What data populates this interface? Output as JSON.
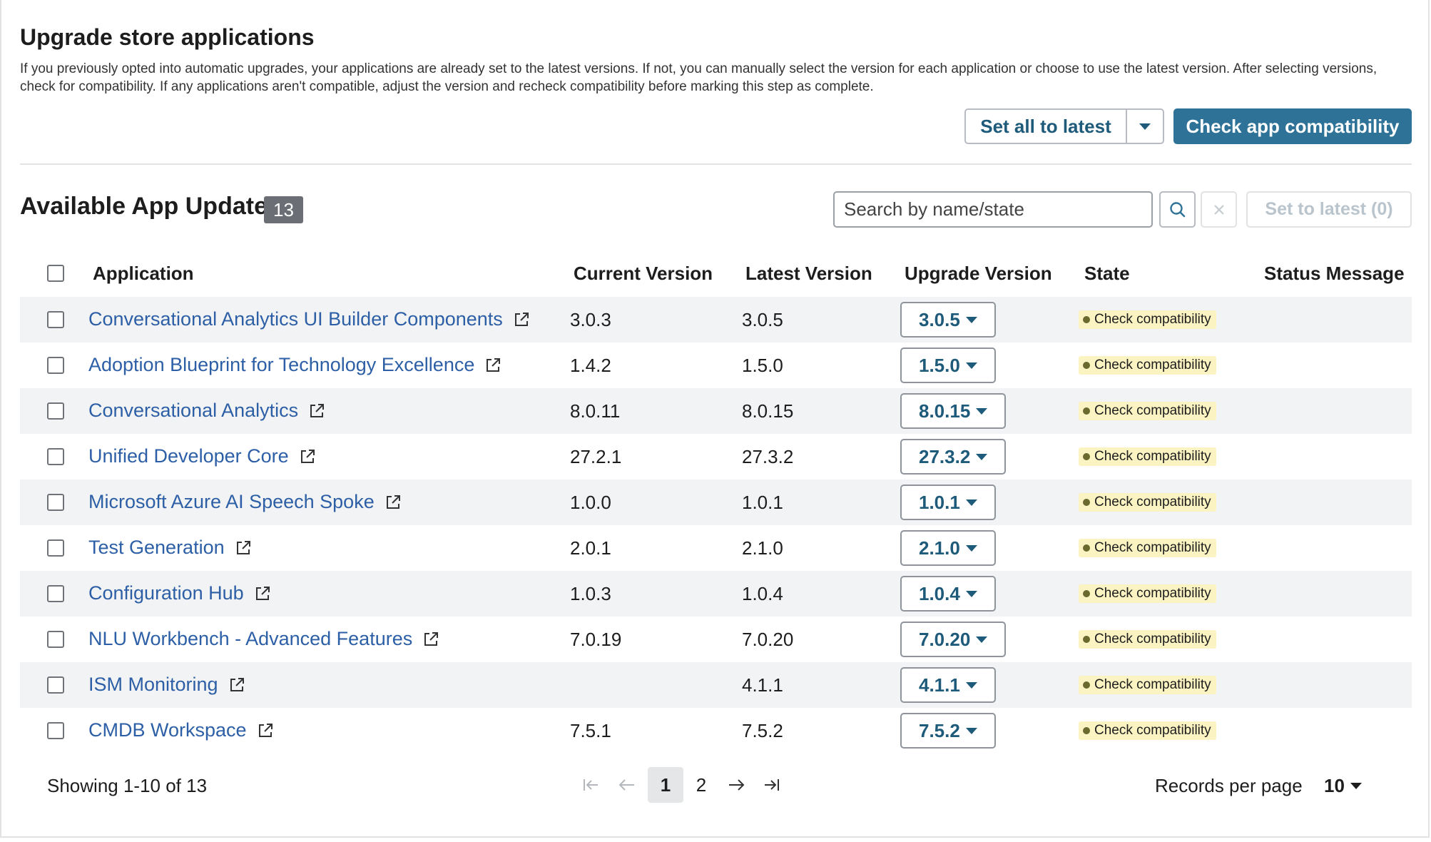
{
  "header": {
    "title": "Upgrade store applications",
    "description": "If you previously opted into automatic upgrades, your applications are already set to the latest versions. If not, you can manually select the version for each application or choose to use the latest version. After selecting versions, check for compatibility. If any applications aren't compatible, adjust the version and recheck compatibility before marking this step as complete.",
    "set_all_label": "Set all to latest",
    "check_compat_label": "Check app compatibility"
  },
  "updates": {
    "title": "Available App Updates",
    "count": "13",
    "search_placeholder": "Search by name/state",
    "set_to_latest_label": "Set to latest (0)"
  },
  "table": {
    "columns": {
      "application": "Application",
      "current": "Current Version",
      "latest": "Latest Version",
      "upgrade": "Upgrade Version",
      "state": "State",
      "status": "Status Message"
    },
    "rows": [
      {
        "name": "Conversational Analytics UI Builder Components",
        "current": "3.0.3",
        "latest": "3.0.5",
        "upgrade": "3.0.5",
        "state": "Check compatibility",
        "status": ""
      },
      {
        "name": "Adoption Blueprint for Technology Excellence",
        "current": "1.4.2",
        "latest": "1.5.0",
        "upgrade": "1.5.0",
        "state": "Check compatibility",
        "status": ""
      },
      {
        "name": "Conversational Analytics",
        "current": "8.0.11",
        "latest": "8.0.15",
        "upgrade": "8.0.15",
        "state": "Check compatibility",
        "status": ""
      },
      {
        "name": "Unified Developer Core",
        "current": "27.2.1",
        "latest": "27.3.2",
        "upgrade": "27.3.2",
        "state": "Check compatibility",
        "status": ""
      },
      {
        "name": "Microsoft Azure AI Speech Spoke",
        "current": "1.0.0",
        "latest": "1.0.1",
        "upgrade": "1.0.1",
        "state": "Check compatibility",
        "status": ""
      },
      {
        "name": "Test Generation",
        "current": "2.0.1",
        "latest": "2.1.0",
        "upgrade": "2.1.0",
        "state": "Check compatibility",
        "status": ""
      },
      {
        "name": "Configuration Hub",
        "current": "1.0.3",
        "latest": "1.0.4",
        "upgrade": "1.0.4",
        "state": "Check compatibility",
        "status": ""
      },
      {
        "name": "NLU Workbench - Advanced Features",
        "current": "7.0.19",
        "latest": "7.0.20",
        "upgrade": "7.0.20",
        "state": "Check compatibility",
        "status": ""
      },
      {
        "name": "ISM Monitoring",
        "current": "",
        "latest": "4.1.1",
        "upgrade": "4.1.1",
        "state": "Check compatibility",
        "status": ""
      },
      {
        "name": "CMDB Workspace",
        "current": "7.5.1",
        "latest": "7.5.2",
        "upgrade": "7.5.2",
        "state": "Check compatibility",
        "status": ""
      }
    ]
  },
  "pagination": {
    "showing": "Showing 1-10 of 13",
    "pages": [
      "1",
      "2"
    ],
    "current_page": "1",
    "records_label": "Records per page",
    "records_value": "10"
  },
  "colors": {
    "primary": "#2e7397",
    "link": "#2d5fa6",
    "state_badge_bg": "#fbf3c2",
    "count_badge_bg": "#6b6f75"
  },
  "icons": {
    "external_link": "external-link-icon",
    "search": "search-icon",
    "clear": "close-icon",
    "dropdown": "chevron-down-icon"
  }
}
